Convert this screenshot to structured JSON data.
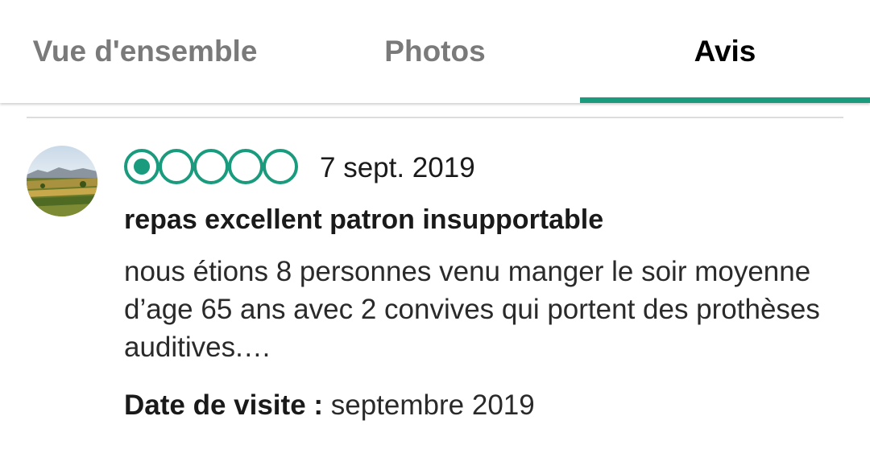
{
  "tabs": {
    "overview": "Vue d'ensemble",
    "photos": "Photos",
    "reviews": "Avis",
    "active": "Avis",
    "accent_color": "#1a9b7e"
  },
  "review": {
    "avatar": "landscape-avatar",
    "rating": 1,
    "rating_max": 5,
    "date": "7 sept. 2019",
    "title": "repas excellent patron insupportable",
    "text": "nous étions 8 personnes venu manger le soir moyenne d’age 65 ans avec 2 convives qui portent des prothèses auditives.…",
    "visit_label": "Date de visite :",
    "visit_value": "septembre 2019"
  }
}
